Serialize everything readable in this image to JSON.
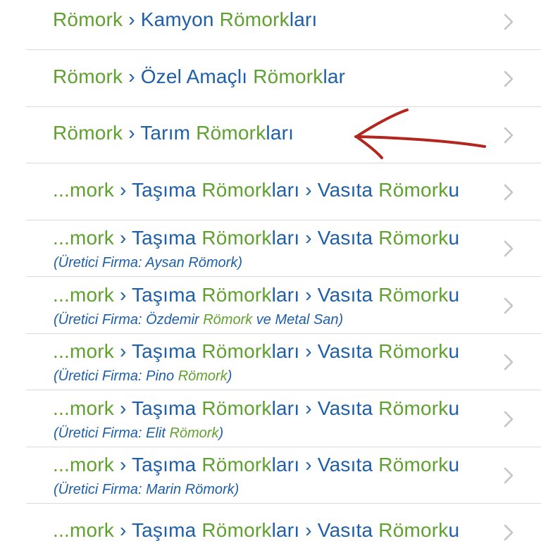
{
  "rows": [
    {
      "parts": [
        [
          "Römork",
          "g"
        ],
        [
          " › ",
          "b"
        ],
        [
          "Kamyon ",
          "b"
        ],
        [
          "Römork",
          "g"
        ],
        [
          "ları",
          "b"
        ]
      ]
    },
    {
      "parts": [
        [
          "Römork",
          "g"
        ],
        [
          " › ",
          "b"
        ],
        [
          "Özel Amaçlı ",
          "b"
        ],
        [
          "Römork",
          "g"
        ],
        [
          "lar",
          "b"
        ]
      ]
    },
    {
      "parts": [
        [
          "Römork",
          "g"
        ],
        [
          " › ",
          "b"
        ],
        [
          "Tarım ",
          "b"
        ],
        [
          "Römork",
          "g"
        ],
        [
          "ları",
          "b"
        ]
      ]
    },
    {
      "parts": [
        [
          "...mork",
          "g"
        ],
        [
          " › ",
          "b"
        ],
        [
          "Taşıma ",
          "b"
        ],
        [
          "Römork",
          "g"
        ],
        [
          "ları",
          "b"
        ],
        [
          " › ",
          "b"
        ],
        [
          "Vasıta ",
          "b"
        ],
        [
          "Römork",
          "g"
        ],
        [
          "u",
          "b"
        ]
      ]
    },
    {
      "parts": [
        [
          "...mork",
          "g"
        ],
        [
          " › ",
          "b"
        ],
        [
          "Taşıma ",
          "b"
        ],
        [
          "Römork",
          "g"
        ],
        [
          "ları",
          "b"
        ],
        [
          " › ",
          "b"
        ],
        [
          "Vasıta ",
          "b"
        ],
        [
          "Römork",
          "g"
        ],
        [
          "u",
          "b"
        ]
      ],
      "sub": [
        [
          "(Üretici Firma: Aysan Römork)",
          "b"
        ]
      ]
    },
    {
      "parts": [
        [
          "...mork",
          "g"
        ],
        [
          " › ",
          "b"
        ],
        [
          "Taşıma ",
          "b"
        ],
        [
          "Römork",
          "g"
        ],
        [
          "ları",
          "b"
        ],
        [
          " › ",
          "b"
        ],
        [
          "Vasıta ",
          "b"
        ],
        [
          "Römork",
          "g"
        ],
        [
          "u",
          "b"
        ]
      ],
      "sub": [
        [
          "(Üretici Firma: Özdemir ",
          "b"
        ],
        [
          "Römork",
          "g"
        ],
        [
          " ve Metal San)",
          "b"
        ]
      ]
    },
    {
      "parts": [
        [
          "...mork",
          "g"
        ],
        [
          " › ",
          "b"
        ],
        [
          "Taşıma ",
          "b"
        ],
        [
          "Römork",
          "g"
        ],
        [
          "ları",
          "b"
        ],
        [
          " › ",
          "b"
        ],
        [
          "Vasıta ",
          "b"
        ],
        [
          "Römork",
          "g"
        ],
        [
          "u",
          "b"
        ]
      ],
      "sub": [
        [
          "(Üretici Firma: Pino ",
          "b"
        ],
        [
          "Römork",
          "g"
        ],
        [
          ")",
          "b"
        ]
      ]
    },
    {
      "parts": [
        [
          "...mork",
          "g"
        ],
        [
          " › ",
          "b"
        ],
        [
          "Taşıma ",
          "b"
        ],
        [
          "Römork",
          "g"
        ],
        [
          "ları",
          "b"
        ],
        [
          " › ",
          "b"
        ],
        [
          "Vasıta ",
          "b"
        ],
        [
          "Römork",
          "g"
        ],
        [
          "u",
          "b"
        ]
      ],
      "sub": [
        [
          "(Üretici Firma: Elit ",
          "b"
        ],
        [
          "Römork",
          "g"
        ],
        [
          ")",
          "b"
        ]
      ]
    },
    {
      "parts": [
        [
          "...mork",
          "g"
        ],
        [
          " › ",
          "b"
        ],
        [
          "Taşıma ",
          "b"
        ],
        [
          "Römork",
          "g"
        ],
        [
          "ları",
          "b"
        ],
        [
          " › ",
          "b"
        ],
        [
          "Vasıta ",
          "b"
        ],
        [
          "Römork",
          "g"
        ],
        [
          "u",
          "b"
        ]
      ],
      "sub": [
        [
          "(Üretici Firma: Marin Römork)",
          "b"
        ]
      ]
    },
    {
      "parts": [
        [
          "...mork",
          "g"
        ],
        [
          " › ",
          "b"
        ],
        [
          "Taşıma ",
          "b"
        ],
        [
          "Römork",
          "g"
        ],
        [
          "ları",
          "b"
        ],
        [
          " › ",
          "b"
        ],
        [
          "Vasıta ",
          "b"
        ],
        [
          "Römork",
          "g"
        ],
        [
          "u",
          "b"
        ]
      ]
    }
  ],
  "colors": {
    "highlight_green": "#5fa12f",
    "link_blue": "#1f5fa8",
    "divider": "#d9d9d9",
    "chevron": "#c4c4c8",
    "annotation_red": "#b3261e"
  },
  "icons": {
    "row_chevron": "chevron-right-icon",
    "annotation": "hand-drawn-arrow-icon"
  }
}
